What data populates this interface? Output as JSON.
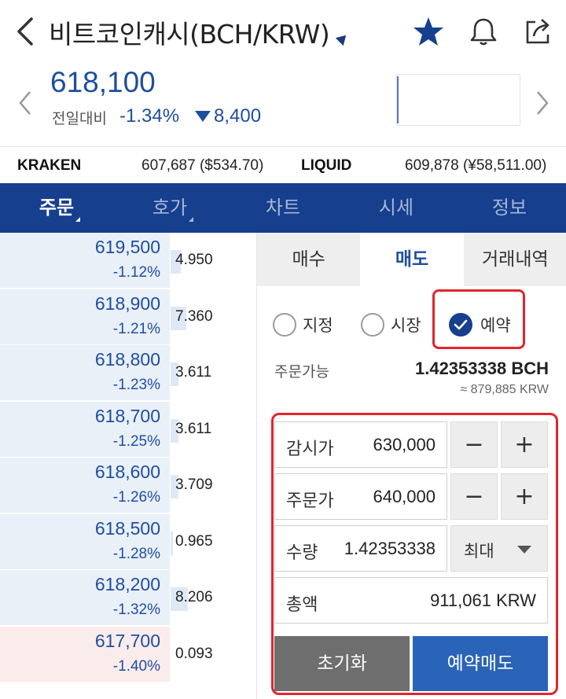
{
  "header": {
    "title": "비트코인캐시(BCH/KRW)",
    "icons": [
      "back-icon",
      "caret-icon",
      "star-icon",
      "bell-icon",
      "share-icon"
    ]
  },
  "ticker": {
    "price": "618,100",
    "change_label": "전일대비",
    "change_pct": "-1.34%",
    "change_amt": "8,400",
    "color": "#1e4ea0"
  },
  "exchanges": [
    {
      "name": "KRAKEN",
      "value": "607,687 ($534.70)"
    },
    {
      "name": "LIQUID",
      "value": "609,878 (¥58,511.00)"
    }
  ],
  "tabs": [
    {
      "label": "주문",
      "active": true,
      "has_caret": true
    },
    {
      "label": "호가",
      "active": false,
      "has_caret": true
    },
    {
      "label": "차트",
      "active": false,
      "has_caret": false
    },
    {
      "label": "시세",
      "active": false,
      "has_caret": false
    },
    {
      "label": "정보",
      "active": false,
      "has_caret": false
    }
  ],
  "orderbook": {
    "rows": [
      {
        "price": "619,500",
        "pct": "-1.12%",
        "qty": "4.950",
        "bar": 0.12,
        "side": "ask"
      },
      {
        "price": "618,900",
        "pct": "-1.21%",
        "qty": "7.360",
        "bar": 0.18,
        "side": "ask"
      },
      {
        "price": "618,800",
        "pct": "-1.23%",
        "qty": "3.611",
        "bar": 0.09,
        "side": "ask"
      },
      {
        "price": "618,700",
        "pct": "-1.25%",
        "qty": "3.611",
        "bar": 0.09,
        "side": "ask"
      },
      {
        "price": "618,600",
        "pct": "-1.26%",
        "qty": "3.709",
        "bar": 0.09,
        "side": "ask"
      },
      {
        "price": "618,500",
        "pct": "-1.28%",
        "qty": "0.965",
        "bar": 0.03,
        "side": "ask"
      },
      {
        "price": "618,200",
        "pct": "-1.32%",
        "qty": "8.206",
        "bar": 0.2,
        "side": "ask"
      },
      {
        "price": "617,700",
        "pct": "-1.40%",
        "qty": "0.093",
        "bar": 0.0,
        "side": "bid"
      }
    ],
    "ask_bg": "#e9f0f8",
    "bid_bg": "#fbecec"
  },
  "order_panel": {
    "tabs": [
      {
        "label": "매수",
        "active": false
      },
      {
        "label": "매도",
        "active": true
      },
      {
        "label": "거래내역",
        "active": false
      }
    ],
    "order_types": [
      {
        "label": "지정",
        "checked": false
      },
      {
        "label": "시장",
        "checked": false
      },
      {
        "label": "예약",
        "checked": true
      }
    ],
    "available_label": "주문가능",
    "available_value": "1.42353338 BCH",
    "available_krw": "≈ 879,885 KRW",
    "watch_price_label": "감시가",
    "watch_price_value": "630,000",
    "order_price_label": "주문가",
    "order_price_value": "640,000",
    "qty_label": "수량",
    "qty_value": "1.42353338",
    "max_label": "최대",
    "total_label": "총액",
    "total_value": "911,061 KRW",
    "minus": "−",
    "plus": "+",
    "reset_label": "초기화",
    "submit_label": "예약매도",
    "accent": "#163f8e",
    "highlight": "#e0262b"
  }
}
